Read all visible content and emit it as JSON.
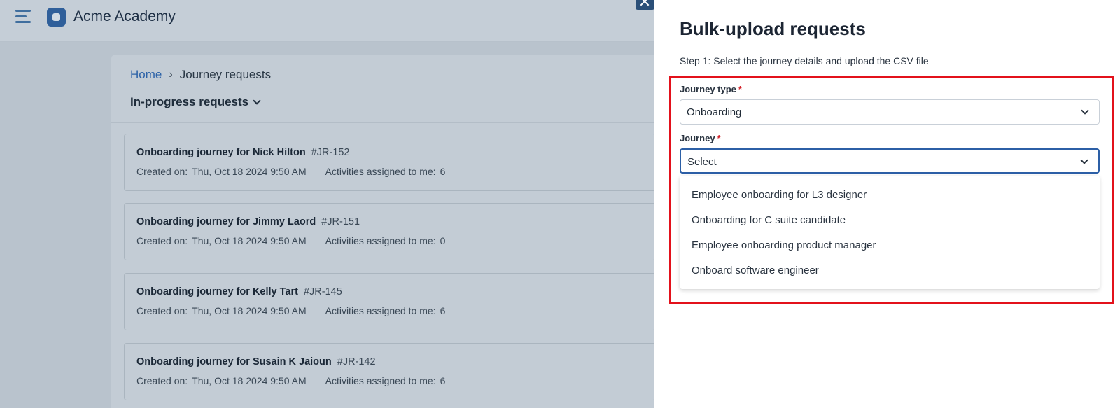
{
  "app": {
    "name": "Acme Academy"
  },
  "breadcrumb": {
    "home": "Home",
    "separator": "›",
    "current": "Journey requests"
  },
  "filter": {
    "label": "In-progress requests"
  },
  "requests": [
    {
      "title": "Onboarding journey for Nick Hilton",
      "id": "#JR-152",
      "created_label": "Created on:",
      "created": "Thu, Oct 18 2024 9:50 AM",
      "activities_label": "Activities assigned to me:",
      "activities": "6"
    },
    {
      "title": "Onboarding journey for Jimmy Laord",
      "id": "#JR-151",
      "created_label": "Created on:",
      "created": "Thu, Oct 18 2024 9:50 AM",
      "activities_label": "Activities assigned to me:",
      "activities": "0"
    },
    {
      "title": "Onboarding journey for Kelly Tart",
      "id": "#JR-145",
      "created_label": "Created on:",
      "created": "Thu, Oct 18 2024 9:50 AM",
      "activities_label": "Activities assigned to me:",
      "activities": "6"
    },
    {
      "title": "Onboarding journey for Susain K Jaioun",
      "id": "#JR-142",
      "created_label": "Created on:",
      "created": "Thu, Oct 18 2024 9:50 AM",
      "activities_label": "Activities assigned to me:",
      "activities": "6"
    }
  ],
  "drawer": {
    "title": "Bulk-upload requests",
    "step": "Step 1: Select the journey details and upload the CSV file",
    "journey_type": {
      "label": "Journey type",
      "required": "*",
      "value": "Onboarding"
    },
    "journey": {
      "label": "Journey",
      "required": "*",
      "placeholder": "Select",
      "options": [
        "Employee onboarding for L3 designer",
        "Onboarding for C suite candidate",
        "Employee onboarding product manager",
        "Onboard software engineer"
      ]
    }
  },
  "colors": {
    "accent": "#2c5fa6",
    "highlight": "#e3111b",
    "required": "#d3222a"
  }
}
